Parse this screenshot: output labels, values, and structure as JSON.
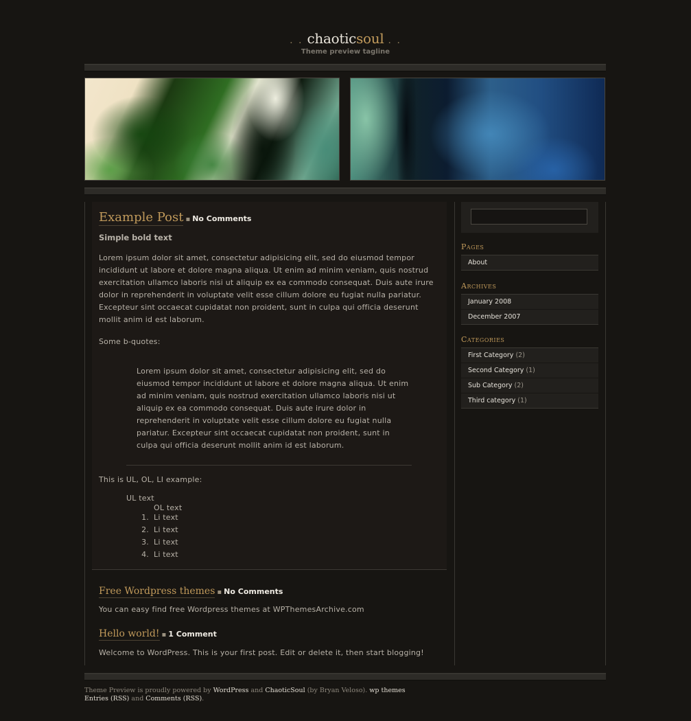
{
  "header": {
    "title_part1": "chaotic",
    "title_part2": "soul",
    "dots_left": ". .",
    "dots_right": ". .",
    "tagline": "Theme preview tagline"
  },
  "posts": [
    {
      "title": "Example Post",
      "separator": "▪",
      "comments": "No Comments",
      "bold_text": "Simple bold text",
      "paragraph": "Lorem ipsum dolor sit amet, consectetur adipisicing elit, sed do eiusmod tempor incididunt ut labore et dolore magna aliqua. Ut enim ad minim veniam, quis nostrud exercitation ullamco laboris nisi ut aliquip ex ea commodo consequat. Duis aute irure dolor in reprehenderit in voluptate velit esse cillum dolore eu fugiat nulla pariatur. Excepteur sint occaecat cupidatat non proident, sunt in culpa qui officia deserunt mollit anim id est laborum.",
      "bquote_intro": "Some b-quotes:",
      "blockquote": "Lorem ipsum dolor sit amet, consectetur adipisicing elit, sed do eiusmod tempor incididunt ut labore et dolore magna aliqua. Ut enim ad minim veniam, quis nostrud exercitation ullamco laboris nisi ut aliquip ex ea commodo consequat. Duis aute irure dolor in reprehenderit in voluptate velit esse cillum dolore eu fugiat nulla pariatur. Excepteur sint occaecat cupidatat non proident, sunt in culpa qui officia deserunt mollit anim id est laborum.",
      "list_intro": "This is UL, OL, LI example:",
      "ul_text": "UL text",
      "ol_text": "OL text",
      "list_items": [
        {
          "num": "1.",
          "text": "Li text"
        },
        {
          "num": "2.",
          "text": "Li text"
        },
        {
          "num": "3.",
          "text": "Li text"
        },
        {
          "num": "4.",
          "text": "Li text"
        }
      ]
    },
    {
      "title": "Free Wordpress themes",
      "separator": "▪",
      "comments": "No Comments",
      "text": "You can easy find free Wordpress themes at WPThemesArchive.com"
    },
    {
      "title": "Hello world!",
      "separator": "▪",
      "comments": "1 Comment",
      "text": "Welcome to WordPress. This is your first post. Edit or delete it, then start blogging!"
    }
  ],
  "sidebar": {
    "search": {
      "value": "",
      "placeholder": ""
    },
    "pages": {
      "heading": "Pages",
      "items": [
        {
          "label": "About"
        }
      ]
    },
    "archives": {
      "heading": "Archives",
      "items": [
        {
          "label": "January 2008"
        },
        {
          "label": "December 2007"
        }
      ]
    },
    "categories": {
      "heading": "Categories",
      "items": [
        {
          "label": "First Category",
          "count": "(2)"
        },
        {
          "label": "Second Category",
          "count": "(1)"
        },
        {
          "label": "Sub Category",
          "count": "(2)"
        },
        {
          "label": "Third category",
          "count": "(1)"
        }
      ]
    }
  },
  "footer": {
    "line1_pre": "Theme Preview is proudly powered by ",
    "wordpress": "WordPress",
    "and1": " and ",
    "chaoticsoul": "ChaoticSoul",
    "by": " (by Bryan Veloso). ",
    "wpthemes": "wp themes",
    "entries_rss": "Entries (RSS)",
    "and2": " and ",
    "comments_rss": "Comments (RSS)",
    "end": "."
  },
  "colors": {
    "background": "#171512",
    "accent": "#c19a5b",
    "text": "#b8b2a8"
  }
}
